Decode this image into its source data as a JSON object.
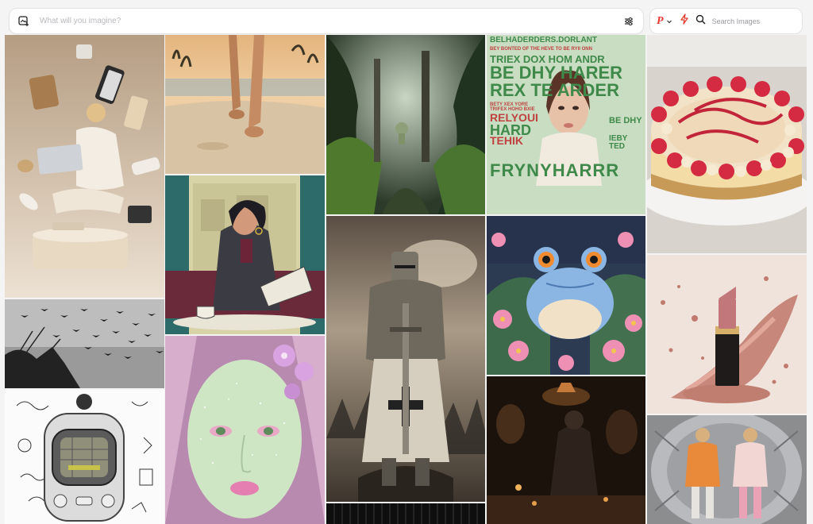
{
  "prompt": {
    "placeholder": "What will you imagine?"
  },
  "search": {
    "placeholder": "Search Images"
  },
  "brand": {
    "logo_letter": "P",
    "accent": "#e4392f"
  },
  "icons": [
    "image-add-icon",
    "sliders-icon",
    "chevron-down-icon",
    "bolt-icon",
    "search-icon"
  ],
  "poster": {
    "lines": [
      "BELHADERDERS.DORLANT",
      "BEY BONTED OF THE HEVE TO BE RYII ONN",
      "TRIEX DOX HOM ANDR",
      "BE DHY HARER",
      "REX TE ARDER",
      "BETY XEX YORE",
      "TRIFEX HOHO BXIE",
      "RELYOUI",
      "HARD",
      "BE DHY",
      "TEHIK",
      "IEBY TED",
      "FRYNYHARRR"
    ]
  }
}
